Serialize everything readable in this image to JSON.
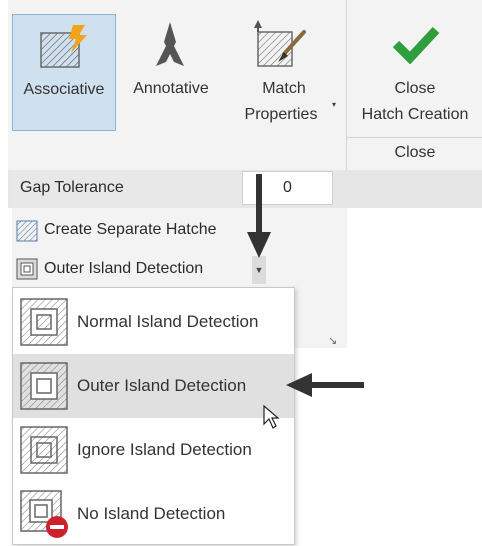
{
  "ribbon": {
    "associative_label": "Associative",
    "annotative_label": "Annotative",
    "match_properties_line1": "Match",
    "match_properties_line2": "Properties",
    "close_line1": "Close",
    "close_line2": "Hatch Creation",
    "close_panel_title": "Close"
  },
  "options": {
    "gap_tolerance_label": "Gap Tolerance",
    "gap_tolerance_value": "0",
    "create_separate_label": "Create Separate Hatche",
    "island_detection_label": "Outer Island Detection"
  },
  "island_menu": {
    "items": [
      {
        "label": "Normal Island Detection"
      },
      {
        "label": "Outer Island Detection"
      },
      {
        "label": "Ignore Island Detection"
      },
      {
        "label": "No Island Detection"
      }
    ],
    "selected": "Outer Island Detection"
  },
  "colors": {
    "selected_bg": "#cfe0ef",
    "check_green": "#2e9e3e",
    "lightning_orange": "#f2a51a",
    "no_red": "#d0202c",
    "hover_bg": "#e0e0e0"
  }
}
